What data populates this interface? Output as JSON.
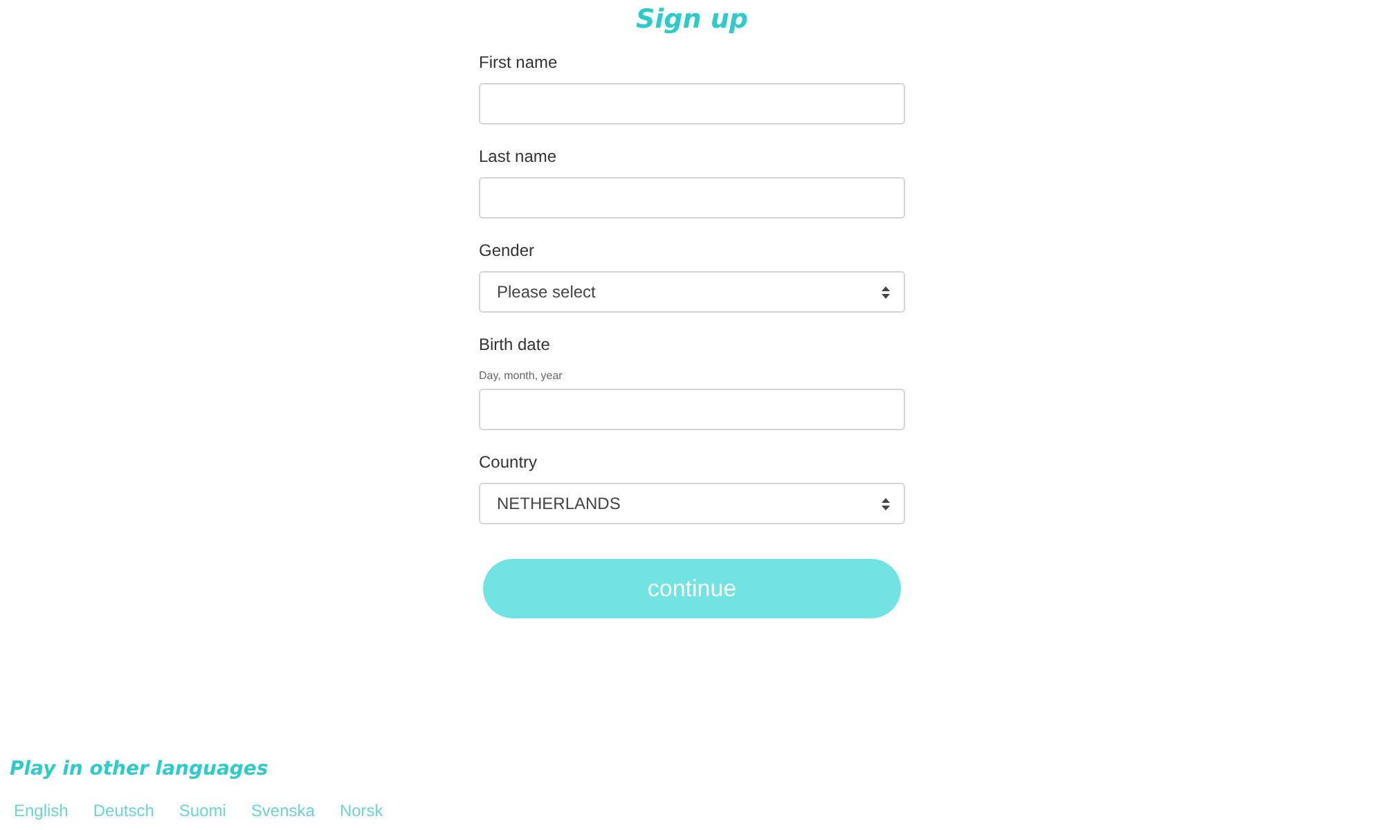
{
  "title": "Sign up",
  "fields": [
    {
      "kind": "text",
      "label": "First name"
    },
    {
      "kind": "text",
      "label": "Last name"
    },
    {
      "kind": "select",
      "label": "Gender",
      "value": "Please select"
    },
    {
      "kind": "text",
      "label": "Birth date",
      "hint": "Day, month, year"
    },
    {
      "kind": "select",
      "label": "Country",
      "value": "NETHERLANDS"
    }
  ],
  "submit_button": {
    "label": "continue"
  },
  "languages": {
    "heading": "Play in other languages",
    "items": [
      "English",
      "Deutsch",
      "Suomi",
      "Svenska",
      "Norsk"
    ]
  }
}
